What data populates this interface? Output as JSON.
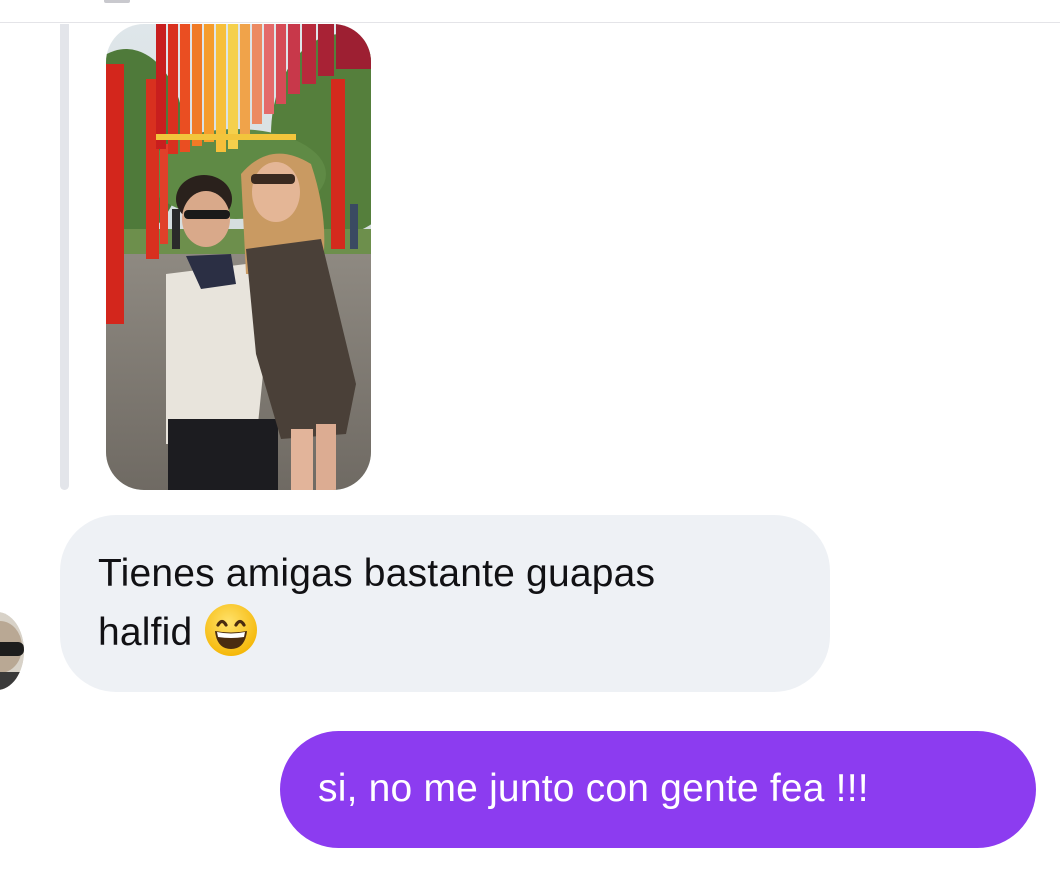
{
  "conversation": {
    "shared_photo": {
      "icon": "photo-image"
    },
    "messages": [
      {
        "direction": "received",
        "line1": "Tienes amigas bastante guapas",
        "line2": "halfid",
        "emoji": "grinning-face-with-smiling-eyes"
      },
      {
        "direction": "sent",
        "text": "si, no me junto con gente fea !!!"
      }
    ]
  },
  "colors": {
    "sent_bubble": "#8c3cf0",
    "received_bubble": "#eef1f5",
    "sent_text": "#ffffff",
    "received_text": "#111114"
  }
}
